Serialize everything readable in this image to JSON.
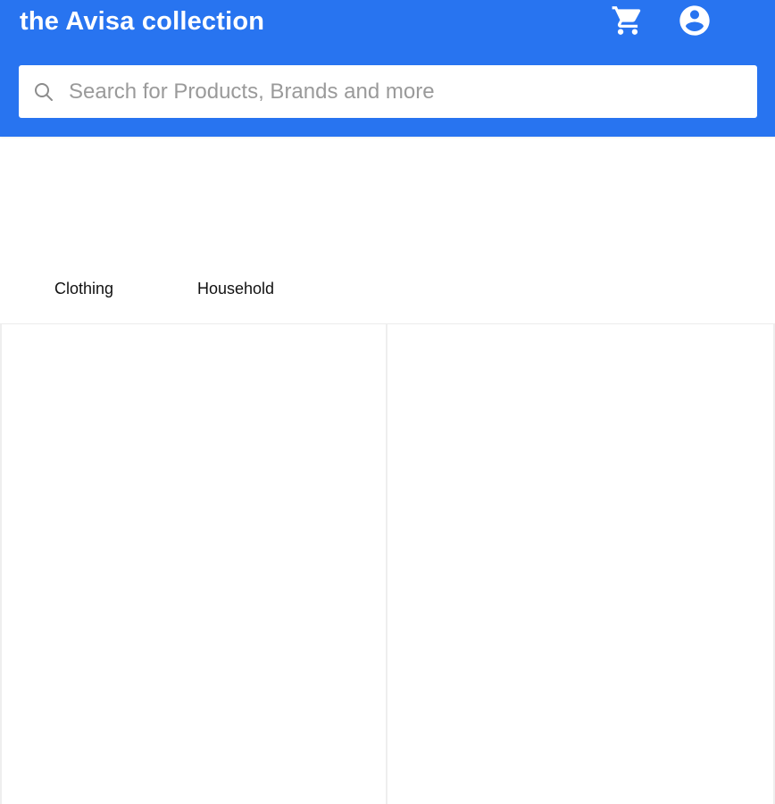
{
  "header": {
    "brand": "the Avisa collection",
    "cart_icon": "cart-icon",
    "account_icon": "account-circle-icon",
    "color": "#2874f0"
  },
  "search": {
    "placeholder": "Search for Products, Brands and more",
    "value": "",
    "icon": "search-icon"
  },
  "tabs": [
    {
      "label": "Clothing"
    },
    {
      "label": "Household"
    }
  ],
  "products": [
    {},
    {}
  ]
}
